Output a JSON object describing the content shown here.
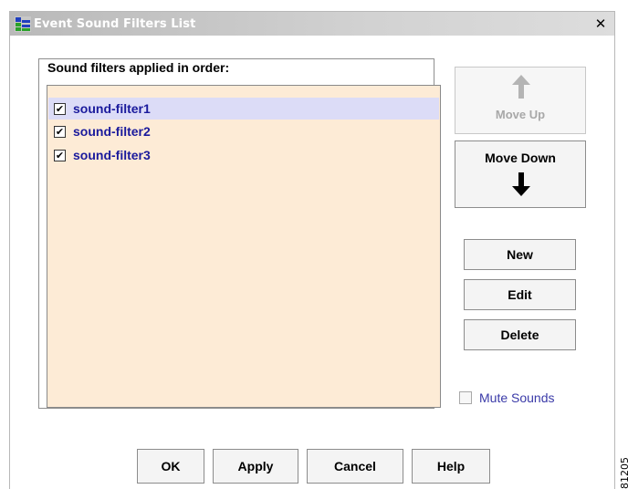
{
  "window": {
    "title": "Event Sound Filters List",
    "close_glyph": "✕"
  },
  "filters": {
    "group_label": "Sound filters applied in order:",
    "items": [
      {
        "label": "sound-filter1",
        "checked": true,
        "selected": true
      },
      {
        "label": "sound-filter2",
        "checked": true,
        "selected": false
      },
      {
        "label": "sound-filter3",
        "checked": true,
        "selected": false
      }
    ],
    "check_glyph": "✔"
  },
  "buttons": {
    "move_up": "Move Up",
    "move_down": "Move Down",
    "new": "New",
    "edit": "Edit",
    "delete": "Delete"
  },
  "mute": {
    "label": "Mute Sounds",
    "checked": false
  },
  "footer": {
    "ok": "OK",
    "apply": "Apply",
    "cancel": "Cancel",
    "help": "Help"
  },
  "figure_id": "81205",
  "colors": {
    "list_background": "#fdebd6",
    "selected_row": "#dcdcf7",
    "item_text": "#1a1a9c",
    "disabled_text": "#a8a8a8"
  },
  "icons": {
    "app": "event-filter-app-icon",
    "up": "arrow-up-icon",
    "down": "arrow-down-icon",
    "close": "close-icon"
  }
}
